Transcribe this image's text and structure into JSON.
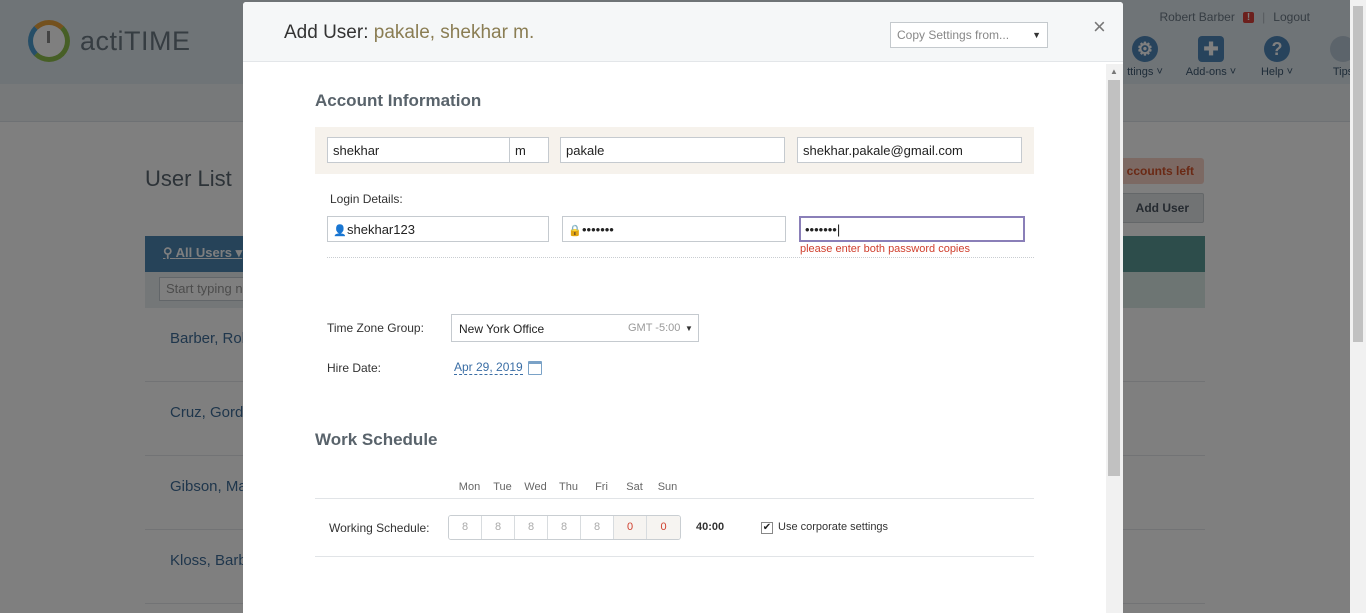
{
  "app": {
    "brand": "actiTIME",
    "user_name": "Robert Barber",
    "warning_badge": "!",
    "logout": "Logout",
    "tools": [
      {
        "label": "ttings ˅",
        "icon": "gear-icon",
        "glyph": "⚙"
      },
      {
        "label": "Add-ons ˅",
        "icon": "puzzle-icon",
        "glyph": "✚"
      },
      {
        "label": "Help ˅",
        "icon": "help-icon",
        "glyph": "?"
      },
      {
        "label": "Tips",
        "icon": "bulb-icon",
        "glyph": "💡"
      }
    ],
    "page_title": "User List",
    "accounts_left": "ccounts left",
    "add_user_button": "Add User",
    "filter_label": "All Users",
    "search_placeholder": "Start typing n",
    "users": [
      "Barber, Rob",
      "Cruz, Gordi",
      "Gibson, Ma",
      "Kloss, Barb"
    ]
  },
  "modal": {
    "title_prefix": "Add User: ",
    "title_name": "pakale, shekhar m.",
    "copy_settings": "Copy Settings from...",
    "close": "×",
    "account_section": "Account Information",
    "first_name": "shekhar",
    "middle_initial": "m",
    "last_name": "pakale",
    "email": "shekhar.pakale@gmail.com",
    "login_details_label": "Login Details:",
    "username": "shekhar123",
    "password": "•••••••",
    "password_confirm": "•••••••",
    "password_error": "please enter both password copies",
    "time_zone_label": "Time Zone Group:",
    "time_zone_value": "New York Office",
    "time_zone_gmt": "GMT -5:00",
    "hire_date_label": "Hire Date:",
    "hire_date": "Apr 29, 2019",
    "work_schedule_section": "Work Schedule",
    "weekdays": [
      "Mon",
      "Tue",
      "Wed",
      "Thu",
      "Fri",
      "Sat",
      "Sun"
    ],
    "working_schedule_label": "Working Schedule:",
    "hours": [
      "8",
      "8",
      "8",
      "8",
      "8",
      "0",
      "0"
    ],
    "total_hours": "40:00",
    "use_corporate_label": "Use corporate settings",
    "use_corporate_checked": "✔"
  }
}
